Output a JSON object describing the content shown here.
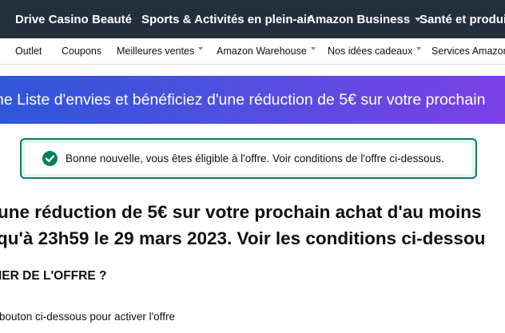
{
  "top_nav": {
    "items": [
      {
        "label": "Drive Casino",
        "has_dropdown": false
      },
      {
        "label": "Beauté",
        "has_dropdown": false
      },
      {
        "label": "Sports & Activités en plein-air",
        "has_dropdown": false
      },
      {
        "label": "Amazon Business",
        "has_dropdown": true
      },
      {
        "label": "Santé et produits",
        "has_dropdown": false
      }
    ],
    "background": "#232f3e"
  },
  "sub_nav": {
    "items": [
      {
        "label": "Outlet",
        "has_dropdown": false
      },
      {
        "label": "Coupons",
        "has_dropdown": false
      },
      {
        "label": "Meilleures ventes",
        "has_dropdown": true
      },
      {
        "label": "Amazon Warehouse",
        "has_dropdown": true
      },
      {
        "label": "Nos idées cadeaux",
        "has_dropdown": true
      },
      {
        "label": "Services Amazon",
        "has_dropdown": false
      }
    ]
  },
  "banner": {
    "text": "ne Liste d'envies et bénéficiez d'une réduction de 5€ sur votre prochain"
  },
  "alert": {
    "icon": "check-circle-icon",
    "message": "Bonne nouvelle, vous êtes éligible à l'offre. Voir conditions de l'offre ci-dessous.",
    "color": "#067d62"
  },
  "main": {
    "headline_line1": "une réduction de 5€ sur votre prochain achat d'au moins",
    "headline_line2": "qu'à 23h59 le 29 mars 2023. Voir les conditions ci-dessou",
    "question": "IER DE L'OFFRE ?",
    "instruction": "bouton ci-dessous pour activer l'offre"
  }
}
